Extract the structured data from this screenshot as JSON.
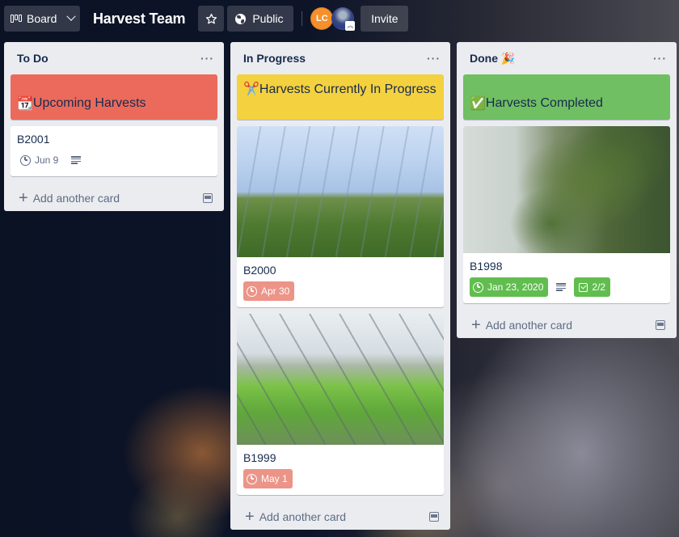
{
  "header": {
    "board_switcher_label": "Board",
    "board_title": "Harvest Team",
    "star_icon": "star-icon",
    "visibility_label": "Public",
    "members": [
      {
        "initials": "LC",
        "color": "#f6902b"
      },
      {
        "initials": "",
        "type": "photo",
        "badge": "admin-chevron"
      }
    ],
    "invite_label": "Invite"
  },
  "lists": [
    {
      "title": "To Do",
      "menu_icon": "···",
      "label_card": {
        "emoji": "📆",
        "text": "Upcoming Harvests",
        "color": "#eb6a5c"
      },
      "cards": [
        {
          "title": "B2001",
          "due": "Jun 9",
          "due_status": "normal",
          "has_description": true
        }
      ],
      "add_card_label": "Add another card"
    },
    {
      "title": "In Progress",
      "menu_icon": "···",
      "label_card": {
        "emoji": "✂️",
        "text": "Harvests Currently In Progress",
        "color": "#f4d13e"
      },
      "cards": [
        {
          "title": "B2000",
          "cover": "greenhouse-lights",
          "due": "Apr 30",
          "due_status": "overdue"
        },
        {
          "title": "B1999",
          "cover": "greenhouse-roof",
          "due": "May 1",
          "due_status": "overdue"
        }
      ],
      "add_card_label": "Add another card"
    },
    {
      "title": "Done",
      "title_emoji": "🎉",
      "menu_icon": "···",
      "label_card": {
        "emoji": "✅",
        "text": "Harvests Completed",
        "color": "#71bf63"
      },
      "cards": [
        {
          "title": "B1998",
          "cover": "bud-closeup",
          "due": "Jan 23, 2020",
          "due_status": "complete",
          "has_description": true,
          "checklist": "2/2"
        }
      ],
      "add_card_label": "Add another card"
    }
  ],
  "colors": {
    "overdue": "#ec9488",
    "complete": "#61bd4f",
    "list_bg": "#ebecf0"
  }
}
